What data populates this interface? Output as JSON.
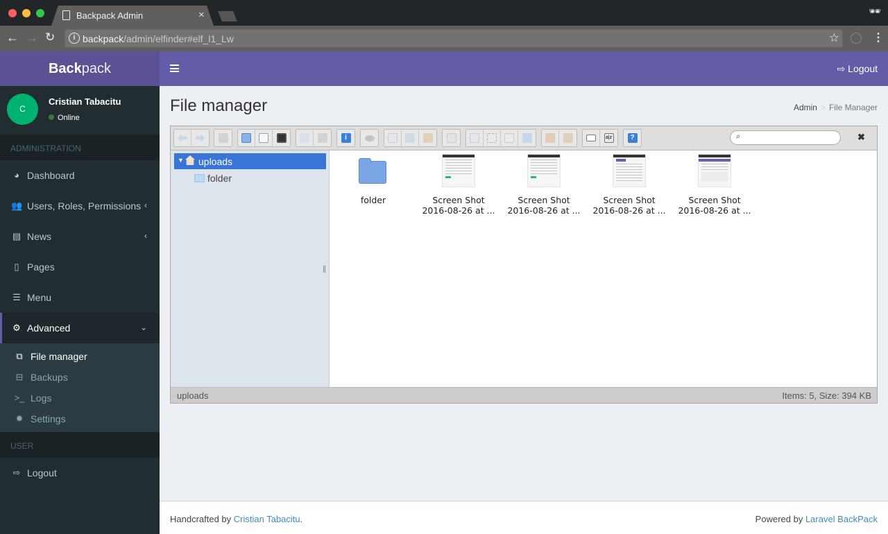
{
  "browser": {
    "tab_title": "Backpack Admin",
    "url_host": "backpack",
    "url_path": "/admin/elfinder#elf_l1_Lw"
  },
  "app": {
    "logo_bold": "Back",
    "logo_light": "pack",
    "top_logout": "Logout",
    "brand_color": "#635ca6"
  },
  "user": {
    "initial": "C",
    "name": "Cristian Tabacitu",
    "status": "Online"
  },
  "sidebar": {
    "header_admin": "ADMINISTRATION",
    "header_user": "USER",
    "items": [
      {
        "label": "Dashboard",
        "icon": "dashboard-icon"
      },
      {
        "label": "Users, Roles, Permissions",
        "icon": "users-icon"
      },
      {
        "label": "News",
        "icon": "newspaper-icon"
      },
      {
        "label": "Pages",
        "icon": "file-icon"
      },
      {
        "label": "Menu",
        "icon": "list-icon"
      },
      {
        "label": "Advanced",
        "icon": "cogs-icon"
      }
    ],
    "subitems": [
      {
        "label": "File manager",
        "icon": "files-icon"
      },
      {
        "label": "Backups",
        "icon": "hdd-icon"
      },
      {
        "label": "Logs",
        "icon": "terminal-icon"
      },
      {
        "label": "Settings",
        "icon": "cog-icon"
      }
    ],
    "logout": "Logout"
  },
  "page": {
    "title": "File manager",
    "breadcrumb": [
      "Admin",
      "File Manager"
    ]
  },
  "elfinder": {
    "tree_root": "uploads",
    "tree_children": [
      "folder"
    ],
    "files": [
      {
        "name": "folder",
        "type": "folder"
      },
      {
        "name_line1": "Screen Shot",
        "name_line2": "2016-08-26 at ...",
        "type": "image"
      },
      {
        "name_line1": "Screen Shot",
        "name_line2": "2016-08-26 at ...",
        "type": "image"
      },
      {
        "name_line1": "Screen Shot",
        "name_line2": "2016-08-26 at ...",
        "type": "image"
      },
      {
        "name_line1": "Screen Shot",
        "name_line2": "2016-08-26 at ...",
        "type": "image"
      }
    ],
    "status_path": "uploads",
    "status_info": "Items: 5, Size: 394 KB",
    "search_value": ""
  },
  "footer": {
    "left_prefix": "Handcrafted by ",
    "left_link": "Cristian Tabacitu",
    "left_suffix": ".",
    "right_prefix": "Powered by ",
    "right_link": "Laravel BackPack"
  }
}
